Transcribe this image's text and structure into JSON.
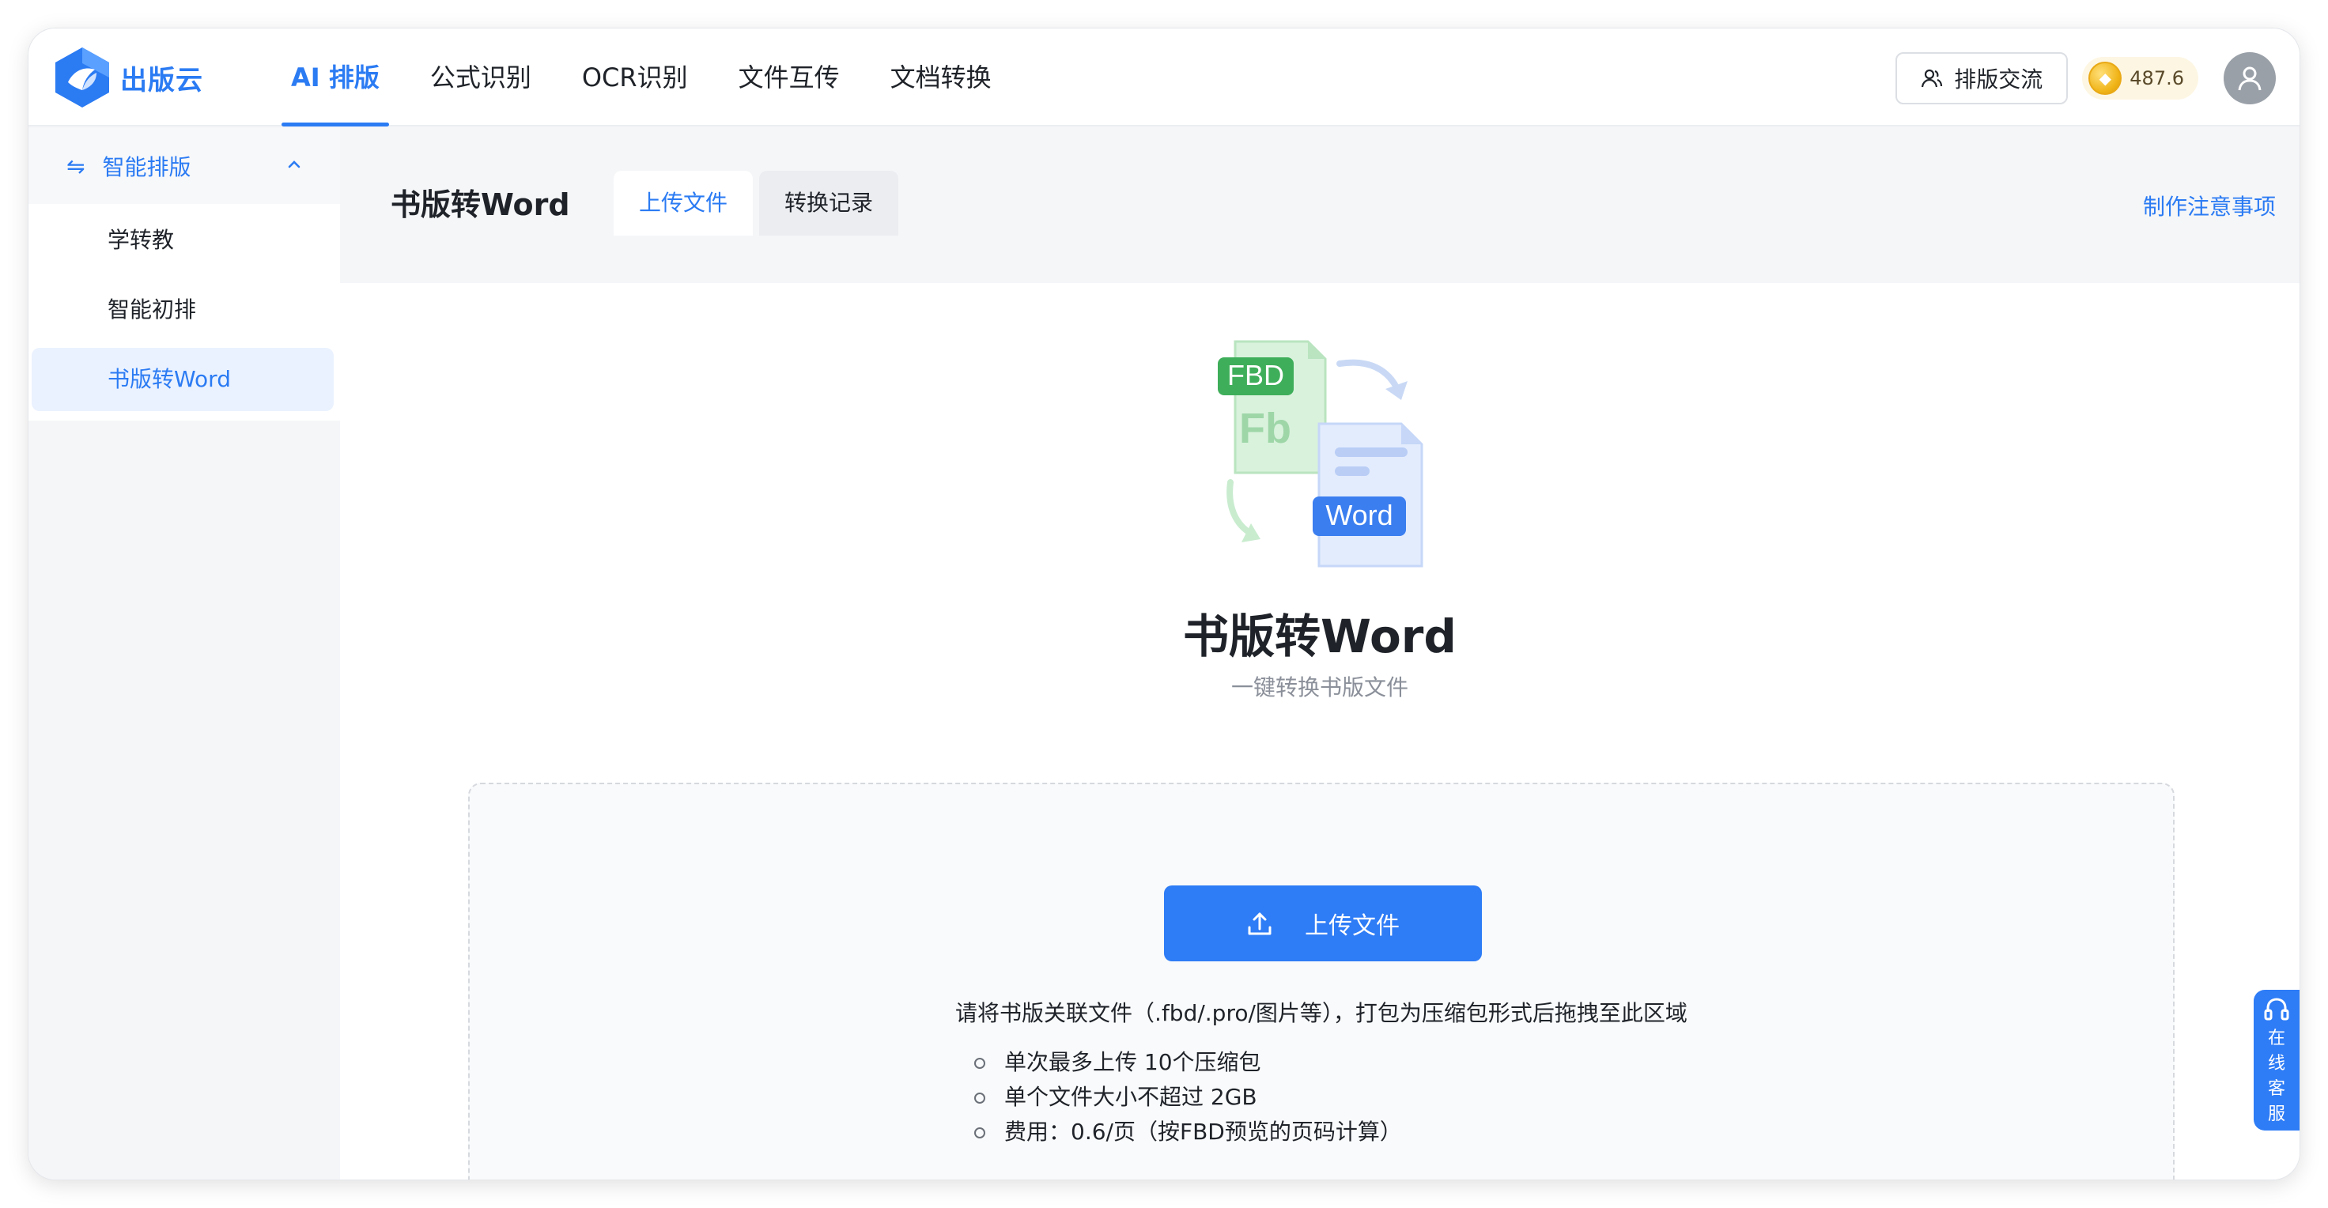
{
  "header": {
    "logo_text": "出版云",
    "nav": [
      {
        "label": "AI 排版",
        "active": true
      },
      {
        "label": "公式识别",
        "active": false
      },
      {
        "label": "OCR识别",
        "active": false
      },
      {
        "label": "文件互传",
        "active": false
      },
      {
        "label": "文档转换",
        "active": false
      }
    ],
    "exchange_label": "排版交流",
    "coin_balance": "487.6"
  },
  "sidebar": {
    "group_label": "智能排版",
    "group_icon": "swap-arrows-icon",
    "items": [
      {
        "label": "学转教",
        "active": false
      },
      {
        "label": "智能初排",
        "active": false
      },
      {
        "label": "书版转Word",
        "active": true
      }
    ]
  },
  "main": {
    "heading": "书版转Word",
    "tabs": [
      {
        "label": "上传文件",
        "active": true
      },
      {
        "label": "转换记录",
        "active": false
      }
    ],
    "notes_link": "制作注意事项",
    "illustration": {
      "source_badge": "FBD",
      "source_letters": "Fb",
      "target_badge": "Word"
    },
    "hero_title": "书版转Word",
    "hero_subtitle": "一键转换书版文件",
    "upload": {
      "button_label": "上传文件",
      "hint": "请将书版关联文件（.fbd/.pro/图片等），打包为压缩包形式后拖拽至此区域",
      "rules": [
        "单次最多上传 10个压缩包",
        "单个文件大小不超过 2GB",
        "费用：0.6/页（按FBD预览的页码计算）"
      ]
    }
  },
  "service": {
    "label": "在线客服"
  },
  "colors": {
    "accent": "#2b7bf3",
    "button": "#2e7cf6",
    "fbd_green": "#3fae5a",
    "word_blue": "#3b7ef0"
  }
}
